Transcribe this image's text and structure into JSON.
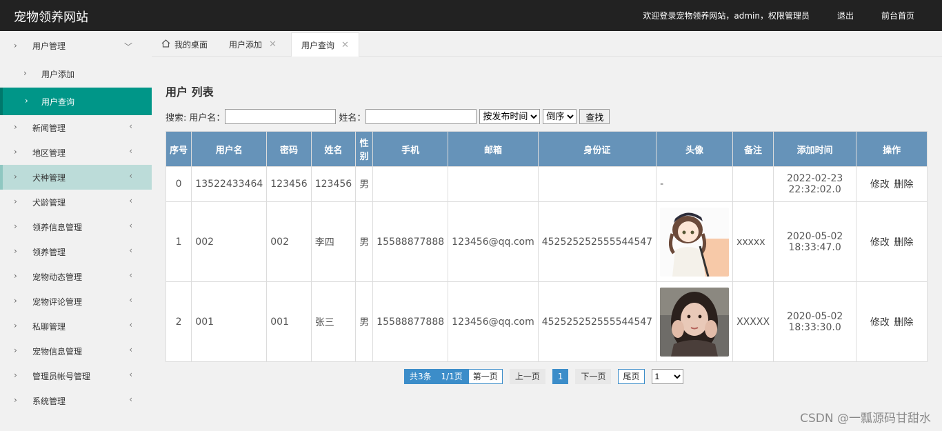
{
  "header": {
    "logo": "宠物领养网站",
    "welcome": "欢迎登录宠物领养网站，admin，权限管理员",
    "logout": "退出",
    "home": "前台首页"
  },
  "sidebar": {
    "items": [
      {
        "label": "用户管理"
      },
      {
        "label": "用户添加"
      },
      {
        "label": "用户查询"
      },
      {
        "label": "新闻管理"
      },
      {
        "label": "地区管理"
      },
      {
        "label": "犬种管理"
      },
      {
        "label": "犬龄管理"
      },
      {
        "label": "领养信息管理"
      },
      {
        "label": "领养管理"
      },
      {
        "label": "宠物动态管理"
      },
      {
        "label": "宠物评论管理"
      },
      {
        "label": "私聊管理"
      },
      {
        "label": "宠物信息管理"
      },
      {
        "label": "管理员帐号管理"
      },
      {
        "label": "系统管理"
      }
    ]
  },
  "tabs": [
    {
      "label": "我的桌面"
    },
    {
      "label": "用户添加"
    },
    {
      "label": "用户查询"
    }
  ],
  "main": {
    "title": "用户 列表",
    "search": {
      "label": "搜索:",
      "username_label": "用户名：",
      "name_label": "姓名：",
      "sort_field": "按发布时间",
      "sort_order": "倒序",
      "find_button": "查找"
    },
    "table": {
      "headers": [
        "序号",
        "用户名",
        "密码",
        "姓名",
        "性别",
        "手机",
        "邮箱",
        "身份证",
        "头像",
        "备注",
        "添加时间",
        "操作"
      ],
      "rows": [
        {
          "idx": "0",
          "username": "13522433464",
          "password": "123456",
          "name": "123456",
          "gender": "男",
          "phone": "",
          "email": "",
          "idcard": "",
          "avatar": "-",
          "remark": "",
          "time1": "2022-02-23",
          "time2": "22:32:02.0"
        },
        {
          "idx": "1",
          "username": "002",
          "password": "002",
          "name": "李四",
          "gender": "男",
          "phone": "15588877888",
          "email": "123456@qq.com",
          "idcard": "452525252555544547",
          "avatar": "",
          "remark": "xxxxx",
          "time1": "2020-05-02",
          "time2": "18:33:47.0"
        },
        {
          "idx": "2",
          "username": "001",
          "password": "001",
          "name": "张三",
          "gender": "男",
          "phone": "15588877888",
          "email": "123456@qq.com",
          "idcard": "452525252555544547",
          "avatar": "",
          "remark": "XXXXX",
          "time1": "2020-05-02",
          "time2": "18:33:30.0"
        }
      ],
      "edit": "修改",
      "delete": "删除"
    },
    "pager": {
      "total": "共3条",
      "pages": "1/1页",
      "first": "第一页",
      "prev": "上一页",
      "current": "1",
      "next": "下一页",
      "last": "尾页",
      "select": "1"
    }
  },
  "watermark": "CSDN @一瓢源码甘甜水",
  "colors": {
    "header_bg": "#222222",
    "active_menu": "#009688",
    "table_header": "#6693b9",
    "pager_blue": "#3c8dc9"
  }
}
